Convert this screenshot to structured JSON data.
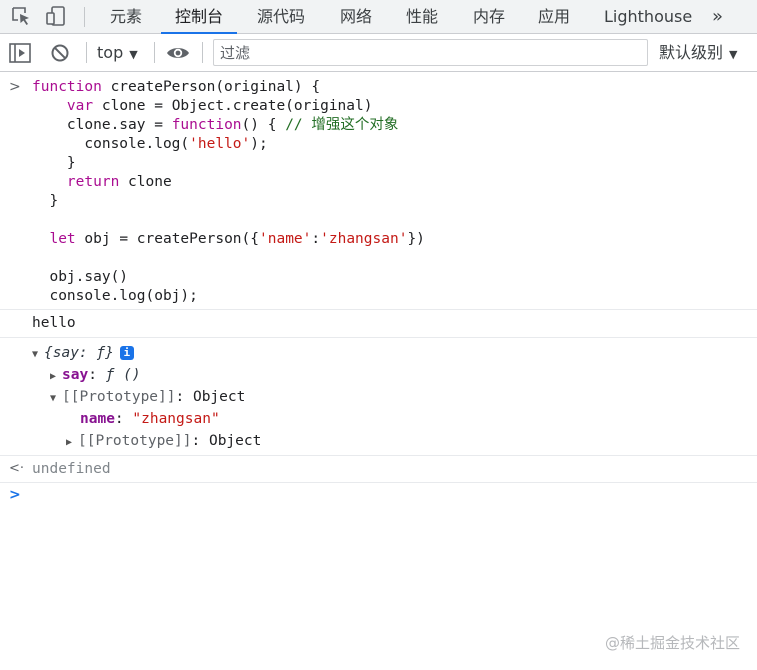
{
  "tabs": {
    "items": [
      "元素",
      "控制台",
      "源代码",
      "网络",
      "性能",
      "内存",
      "应用",
      "Lighthouse"
    ],
    "active": "控制台",
    "more": "»"
  },
  "toolbar": {
    "context": "top",
    "filter_placeholder": "过滤",
    "filter_value": "",
    "levels": "默认级别"
  },
  "console": {
    "input_code": [
      "function createPerson(original) {",
      "    var clone = Object.create(original)",
      "    clone.say = function() { // 增强这个对象",
      "      console.log('hello');",
      "    }",
      "    return clone",
      "  }",
      "",
      "  let obj = createPerson({'name':'zhangsan'})",
      "",
      "  obj.say()",
      "  console.log(obj);"
    ],
    "log_output": "hello",
    "object_preview": {
      "summary": "{say: ƒ}",
      "info": "i",
      "say_key": "say",
      "say_value": "ƒ ()",
      "proto_key": "[[Prototype]]",
      "proto_value": "Object",
      "name_key": "name",
      "name_value": "\"zhangsan\"",
      "inner_proto_key": "[[Prototype]]",
      "inner_proto_value": "Object"
    },
    "return_value": "undefined"
  },
  "colors": {
    "accent": "#1a73e8",
    "keyword": "#aa0d91",
    "comment": "#236e25",
    "string": "#c41a16"
  },
  "watermark": "@稀土掘金技术社区"
}
